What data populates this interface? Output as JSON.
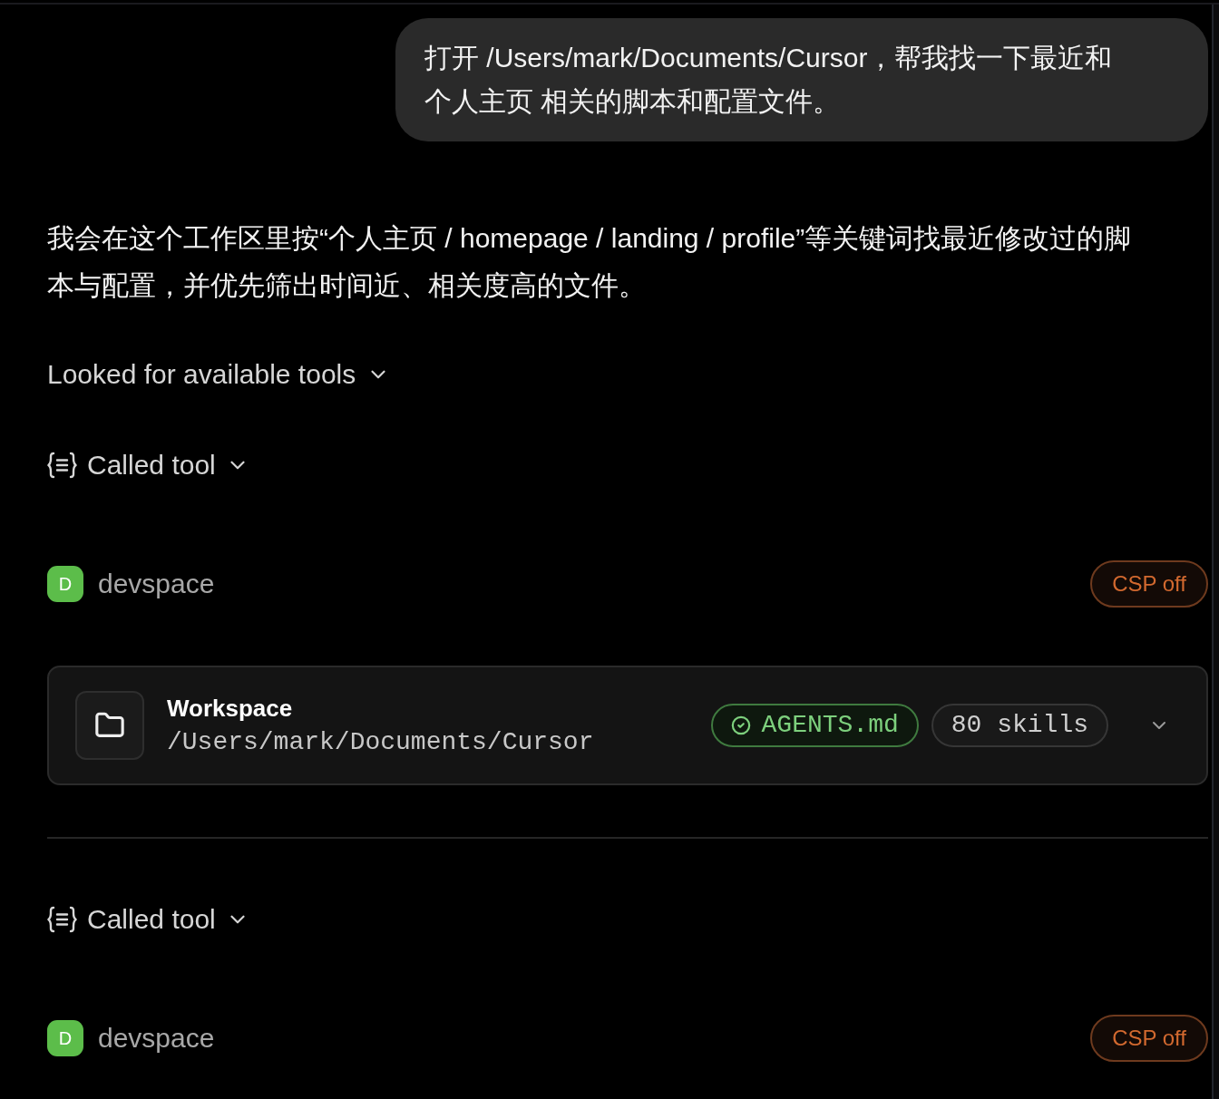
{
  "user_message": {
    "text": "打开 /Users/mark/Documents/Cursor，帮我找一下最近和个人主页 相关的脚本和配置文件。"
  },
  "assistant_message": {
    "text": "我会在这个工作区里按“个人主页 / homepage / landing / profile”等关键词找最近修改过的脚本与配置，并优先筛出时间近、相关度高的文件。"
  },
  "steps": [
    {
      "kind": "collapsible",
      "label": "Looked for available tools"
    },
    {
      "kind": "tool",
      "label": "Called tool"
    },
    {
      "kind": "server",
      "avatar": "D",
      "name": "devspace",
      "badge": "CSP off"
    },
    {
      "kind": "workspace",
      "title": "Workspace",
      "path": "/Users/mark/Documents/Cursor",
      "tags": [
        {
          "kind": "ok",
          "label": "AGENTS.md"
        },
        {
          "kind": "plain",
          "label": "80 skills"
        }
      ]
    },
    {
      "kind": "divider"
    },
    {
      "kind": "tool",
      "label": "Called tool"
    },
    {
      "kind": "server",
      "avatar": "D",
      "name": "devspace",
      "badge": "CSP off"
    }
  ]
}
